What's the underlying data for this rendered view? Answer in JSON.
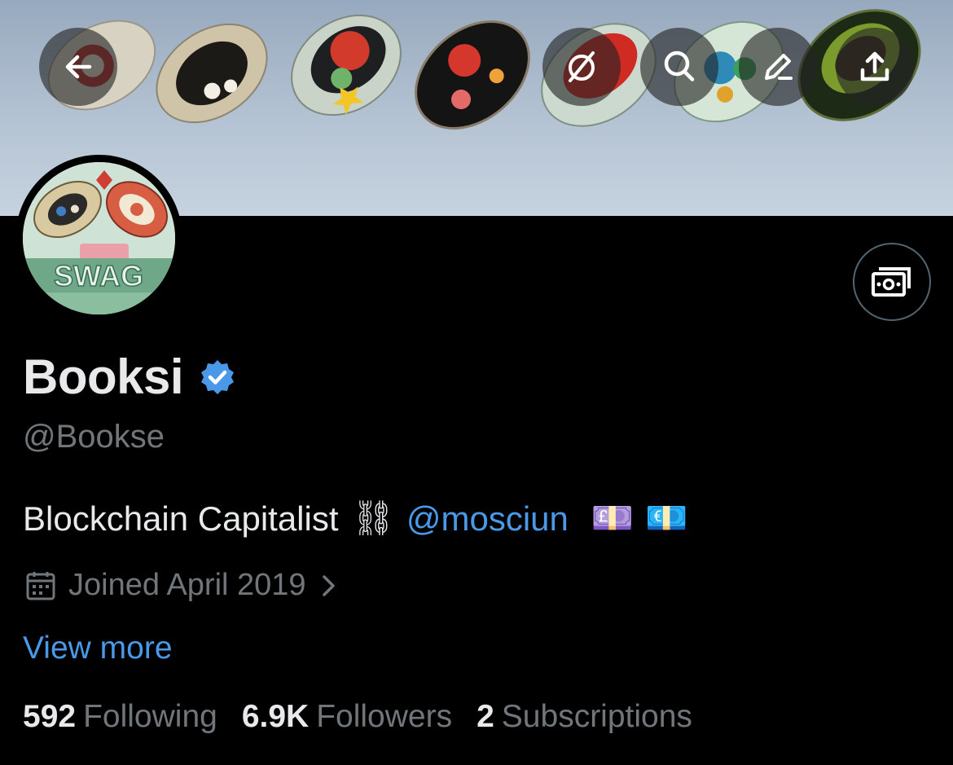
{
  "profile": {
    "display_name": "Booksi",
    "handle": "@Bookse",
    "verified": true,
    "bio_text": "Blockchain Capitalist",
    "bio_chain_emoji": "⛓",
    "bio_mention": "@mosciun",
    "bio_pound_emoji": "💷",
    "bio_euro_emoji": "💶",
    "joined": "Joined April 2019",
    "view_more": "View more"
  },
  "stats": [
    {
      "value": "592",
      "label": "Following"
    },
    {
      "value": "6.9K",
      "label": "Followers"
    },
    {
      "value": "2",
      "label": "Subscriptions"
    }
  ],
  "header_buttons": {
    "back": "arrow-left-icon",
    "grok": "grok-slash-icon",
    "search": "search-icon",
    "edit": "pencil-icon",
    "share": "share-icon"
  },
  "colors": {
    "accent": "#4a99e9",
    "verified": "#4a99e9",
    "secondary_text": "#71767b",
    "background": "#000000"
  }
}
